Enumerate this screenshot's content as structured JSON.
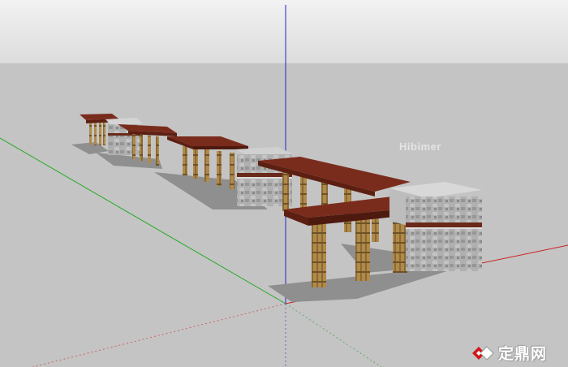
{
  "viewport": {
    "sky_color": "#e6e6e6",
    "ground_color": "#c4c4c4",
    "axis_colors": {
      "red": "#cc2222",
      "green": "#22aa22",
      "blue": "#2222cc"
    }
  },
  "model": {
    "wood_color": "#7a2c1c",
    "bamboo_color": "#b08a4a",
    "stone_color": "#a8a8a8"
  },
  "watermarks": {
    "hibimer": "Hibimer",
    "brand_text": "定鼎网",
    "brand_icon": "diamond-logo-icon"
  }
}
